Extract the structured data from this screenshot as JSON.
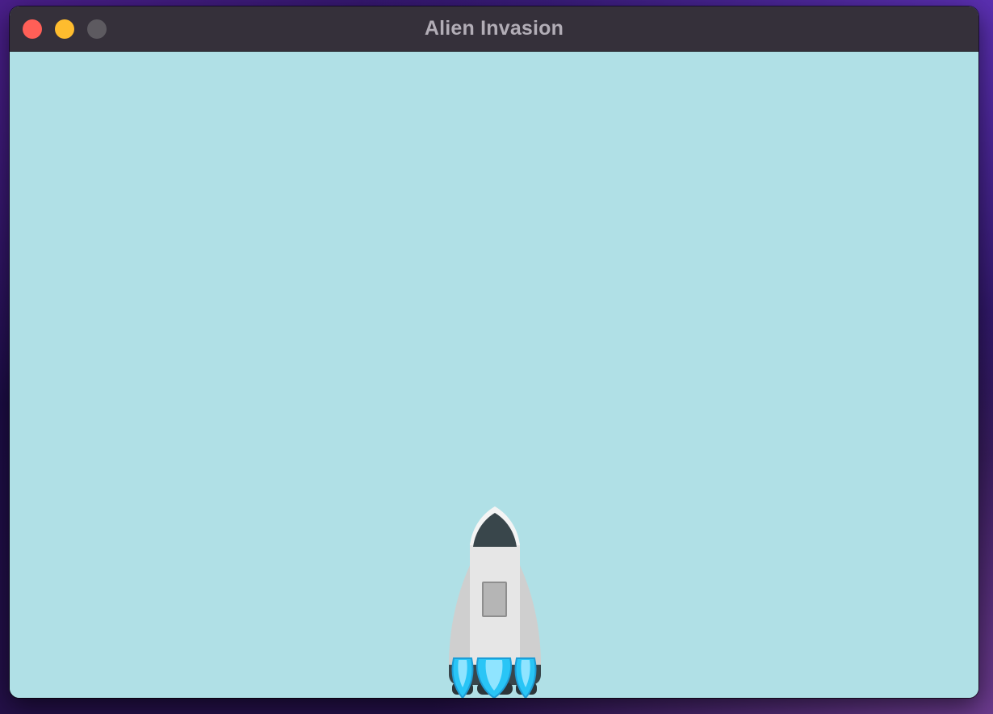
{
  "window": {
    "title": "Alien Invasion"
  },
  "titlebar": {
    "buttons": [
      {
        "name": "close",
        "color": "#ff5f57"
      },
      {
        "name": "minimize",
        "color": "#febc2e"
      },
      {
        "name": "zoom",
        "color": "#5d5a60"
      }
    ]
  },
  "game": {
    "background_color": "#b0e0e6",
    "ship": {
      "icon": "rocket-ship-icon",
      "body_color": "#e6e6e6",
      "nose_color": "#39464b",
      "flame_color": "#29c5f6"
    }
  }
}
